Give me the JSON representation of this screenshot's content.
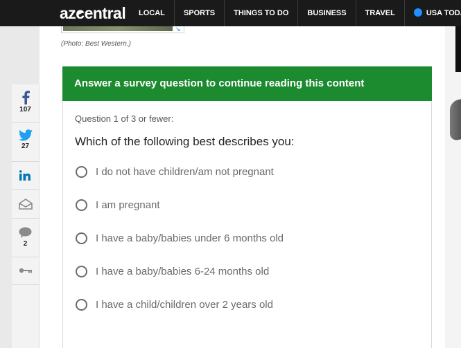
{
  "brand": {
    "logo_prefix": "az",
    "logo_z": "c",
    "logo_suffix": "entral"
  },
  "nav": {
    "items": [
      "LOCAL",
      "SPORTS",
      "THINGS TO DO",
      "BUSINESS",
      "TRAVEL"
    ],
    "partner": "USA TODAY"
  },
  "article": {
    "photo_caption": "(Photo: Best Western.)"
  },
  "share": {
    "facebook_count": "107",
    "twitter_count": "27",
    "comments_count": "2"
  },
  "survey": {
    "header": "Answer a survey question to continue reading this content",
    "progress": "Question 1 of 3 or fewer:",
    "question": "Which of the following best describes you:",
    "options": [
      "I do not have children/am not pregnant",
      "I am pregnant",
      "I have a baby/babies under 6 months old",
      "I have a baby/babies 6-24 months old",
      "I have a child/children over 2 years old"
    ]
  },
  "colors": {
    "survey_green": "#1c8a2e",
    "facebook": "#3b5998",
    "twitter": "#1da1f2",
    "linkedin": "#0077b5"
  }
}
